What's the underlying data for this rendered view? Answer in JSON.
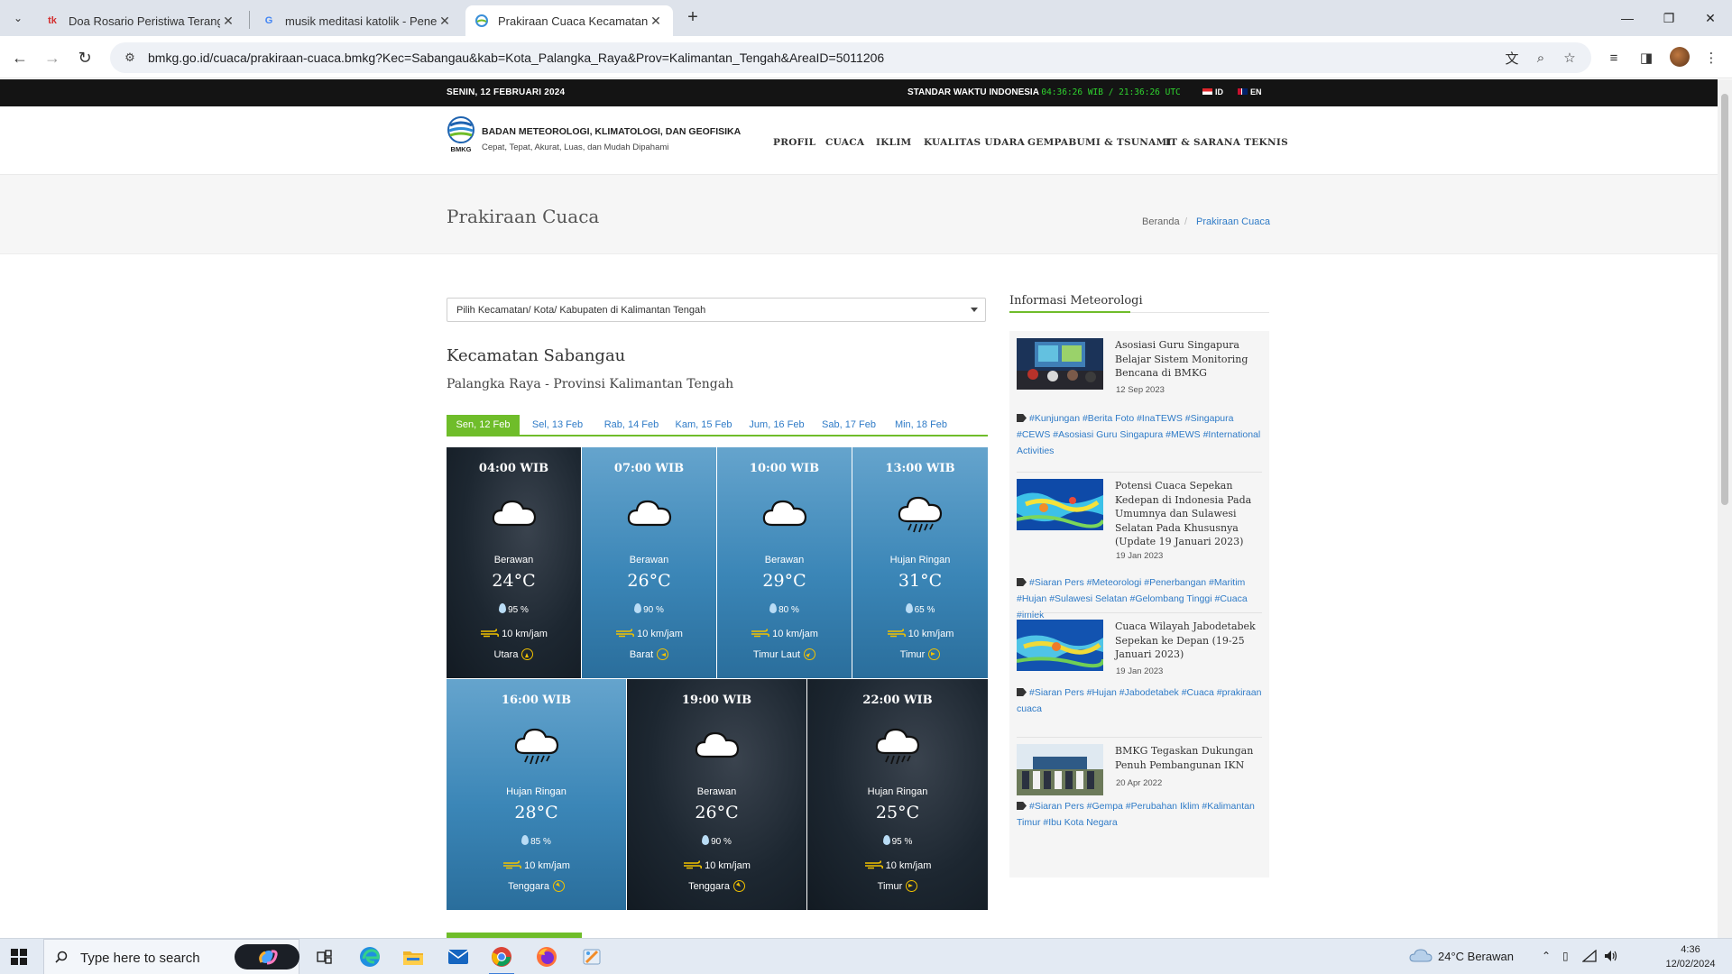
{
  "browser": {
    "tabs": [
      {
        "title": "Doa Rosario Peristiwa Terang - ",
        "favicon": "tk"
      },
      {
        "title": "musik meditasi katolik - Penelu",
        "favicon": "G"
      },
      {
        "title": "Prakiraan Cuaca Kecamatan Sab",
        "favicon": ""
      }
    ],
    "url": "bmkg.go.id/cuaca/prakiraan-cuaca.bmkg?Kec=Sabangau&kab=Kota_Palangka_Raya&Prov=Kalimantan_Tengah&AreaID=5011206"
  },
  "topbar": {
    "date": "SENIN, 12 FEBRUARI 2024",
    "std_label": "STANDAR WAKTU INDONESIA",
    "clock": "04:36:26 WIB / 21:36:26 UTC",
    "lang_id": "ID",
    "lang_en": "EN"
  },
  "header": {
    "logo_text": "BMKG",
    "org": "BADAN METEOROLOGI, KLIMATOLOGI, DAN GEOFISIKA",
    "tagline": "Cepat, Tepat, Akurat, Luas, dan Mudah Dipahami",
    "nav": [
      "PROFIL",
      "CUACA",
      "IKLIM",
      "KUALITAS UDARA",
      "GEMPABUMI & TSUNAMI",
      "IT & SARANA TEKNIS"
    ]
  },
  "titlebar": {
    "title": "Prakiraan Cuaca",
    "crumb_home": "Beranda",
    "crumb_sep": "/",
    "crumb_current": "Prakiraan Cuaca"
  },
  "location": {
    "select_label": "Pilih Kecamatan/ Kota/ Kabupaten di Kalimantan Tengah",
    "kecamatan": "Kecamatan Sabangau",
    "province": "Palangka Raya - Provinsi Kalimantan Tengah"
  },
  "days": [
    "Sen, 12 Feb",
    "Sel, 13 Feb",
    "Rab, 14 Feb",
    "Kam, 15 Feb",
    "Jum, 16 Feb",
    "Sab, 17 Feb",
    "Min, 18 Feb"
  ],
  "forecast": [
    {
      "time": "04:00 WIB",
      "condition": "Berawan",
      "temp": "24°C",
      "humidity": "95 %",
      "wind": "10 km/jam",
      "direction": "Utara",
      "icon": "cloud-icon"
    },
    {
      "time": "07:00 WIB",
      "condition": "Berawan",
      "temp": "26°C",
      "humidity": "90 %",
      "wind": "10 km/jam",
      "direction": "Barat",
      "icon": "cloud-icon"
    },
    {
      "time": "10:00 WIB",
      "condition": "Berawan",
      "temp": "29°C",
      "humidity": "80 %",
      "wind": "10 km/jam",
      "direction": "Timur Laut",
      "icon": "cloud-icon"
    },
    {
      "time": "13:00 WIB",
      "condition": "Hujan Ringan",
      "temp": "31°C",
      "humidity": "65 %",
      "wind": "10 km/jam",
      "direction": "Timur",
      "icon": "rain-cloud-icon"
    },
    {
      "time": "16:00 WIB",
      "condition": "Hujan Ringan",
      "temp": "28°C",
      "humidity": "85 %",
      "wind": "10 km/jam",
      "direction": "Tenggara",
      "icon": "rain-cloud-icon"
    },
    {
      "time": "19:00 WIB",
      "condition": "Berawan",
      "temp": "26°C",
      "humidity": "90 %",
      "wind": "10 km/jam",
      "direction": "Tenggara",
      "icon": "cloud-icon"
    },
    {
      "time": "22:00 WIB",
      "condition": "Hujan Ringan",
      "temp": "25°C",
      "humidity": "95 %",
      "wind": "10 km/jam",
      "direction": "Timur",
      "icon": "rain-cloud-icon"
    }
  ],
  "sidebar": {
    "heading": "Informasi Meteorologi",
    "news": [
      {
        "title": "Asosiasi Guru Singapura Belajar Sistem Monitoring Bencana di BMKG",
        "date": "12 Sep 2023",
        "tags": "#Kunjungan #Berita Foto #InaTEWS #Singapura #CEWS #Asosiasi Guru Singapura #MEWS #International Activities"
      },
      {
        "title": "Potensi Cuaca Sepekan Kedepan di Indonesia Pada Umumnya dan Sulawesi Selatan Pada Khususnya (Update 19 Januari 2023)",
        "date": "19 Jan 2023",
        "tags": "#Siaran Pers #Meteorologi #Penerbangan #Maritim #Hujan #Sulawesi Selatan #Gelombang Tinggi #Cuaca #imlek"
      },
      {
        "title": "Cuaca Wilayah Jabodetabek Sepekan ke Depan (19-25 Januari 2023)",
        "date": "19 Jan 2023",
        "tags": "#Siaran Pers #Hujan #Jabodetabek #Cuaca #prakiraan cuaca"
      },
      {
        "title": "BMKG Tegaskan Dukungan Penuh Pembangunan IKN",
        "date": "20 Apr 2022",
        "tags": "#Siaran Pers #Gempa #Perubahan Iklim #Kalimantan Timur #Ibu Kota Negara"
      }
    ]
  },
  "taskbar": {
    "search_placeholder": "Type here to search",
    "weather": "24°C  Berawan",
    "time": "4:36",
    "date": "12/02/2024"
  }
}
